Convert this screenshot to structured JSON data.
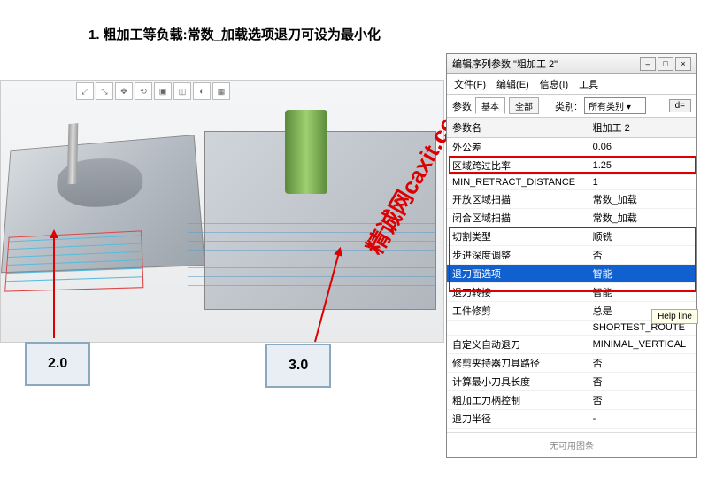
{
  "title": "1. 粗加工等负载:常数_加载选项退刀可设为最小化",
  "callouts": {
    "one": "2.0",
    "two": "3.0"
  },
  "watermark": "精诚网caxit.com",
  "panel": {
    "title": "编辑序列参数 \"粗加工 2\"",
    "menu": {
      "file": "文件(F)",
      "edit": "编辑(E)",
      "info": "信息(I)",
      "tools": "工具"
    },
    "tabs": {
      "label": "参数",
      "basic": "基本",
      "all": "全部",
      "cat_label": "类别:",
      "cat_value": "所有类别",
      "unit": "d="
    },
    "cols": {
      "name": "参数名",
      "val": "粗加工 2"
    },
    "rows": [
      {
        "n": "外公差",
        "v": "0.06"
      },
      {
        "n": "区域跨过比率",
        "v": "1.25"
      },
      {
        "n": "MIN_RETRACT_DISTANCE",
        "v": "1"
      },
      {
        "n": "开放区域扫描",
        "v": "常数_加载"
      },
      {
        "n": "闭合区域扫描",
        "v": "常数_加载"
      },
      {
        "n": "切割类型",
        "v": "顺铣"
      },
      {
        "n": "步进深度调整",
        "v": "否"
      },
      {
        "n": "退刀面选项",
        "v": "智能",
        "hl": true
      },
      {
        "n": "退刀转接",
        "v": "智能"
      },
      {
        "n": "工件修剪",
        "v": "总是"
      },
      {
        "n": "",
        "v": "SHORTEST_ROUTE"
      },
      {
        "n": "自定义自动退刀",
        "v": "MINIMAL_VERTICAL"
      },
      {
        "n": "修剪夹持器刀具路径",
        "v": "否"
      },
      {
        "n": "计算最小刀具长度",
        "v": "否"
      },
      {
        "n": "粗加工刀柄控制",
        "v": "否"
      },
      {
        "n": "退刀半径",
        "v": "-"
      }
    ],
    "help": "Help line",
    "footer": "无可用图条"
  }
}
